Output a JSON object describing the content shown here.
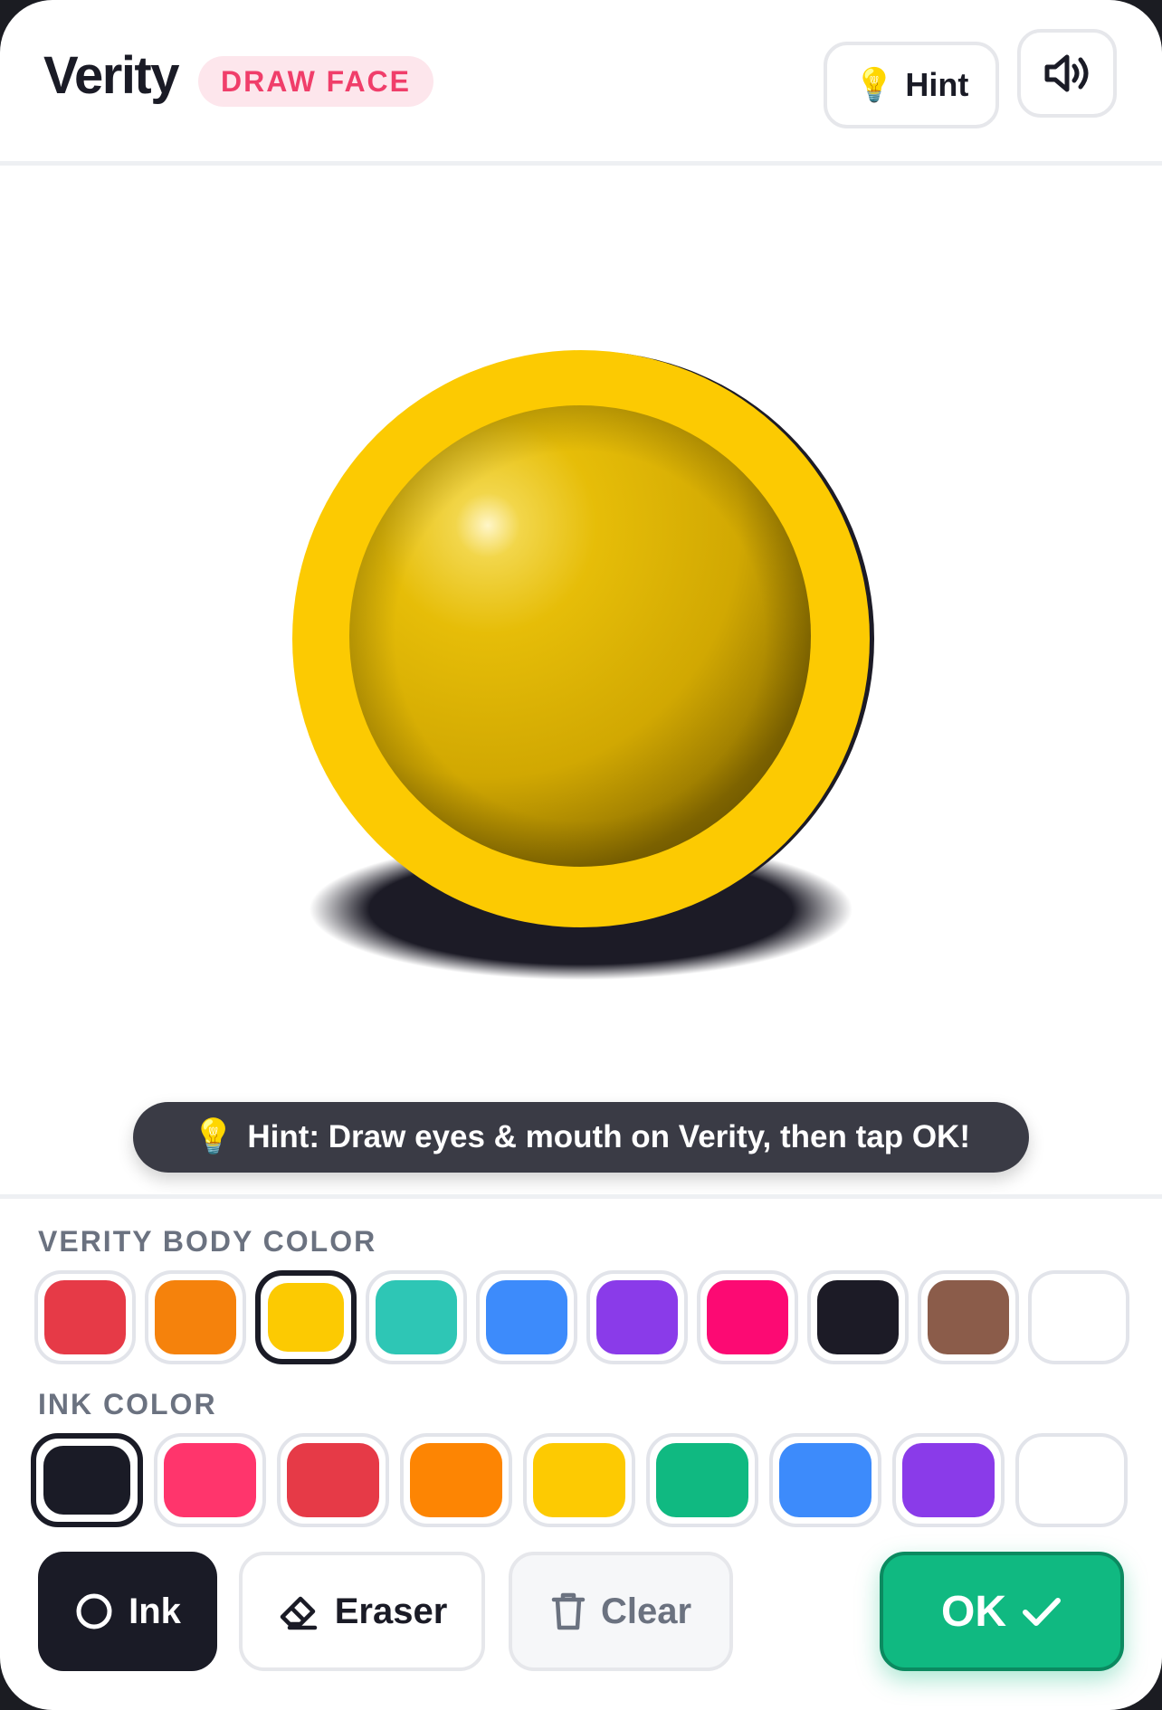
{
  "header": {
    "title": "Verity",
    "mode_badge": "DRAW FACE",
    "hint_label": "Hint",
    "hint_icon": "💡"
  },
  "canvas": {
    "hint_icon": "💡",
    "hint_text": "Hint: Draw eyes & mouth on Verity, then tap OK!"
  },
  "body_palette": {
    "label": "VERITY BODY COLOR",
    "selected": "#fcca02",
    "colors": [
      "#e63a47",
      "#f5820c",
      "#fcca02",
      "#2ec6b5",
      "#3d8bfb",
      "#8a3be9",
      "#fc0a73",
      "#1c1b26",
      "#8b5c4a",
      "#ffffff"
    ]
  },
  "ink_palette": {
    "label": "INK COLOR",
    "selected": "#1a1b26",
    "colors": [
      "#1a1b26",
      "#ff356c",
      "#e63a47",
      "#fd8503",
      "#fdca02",
      "#10b981",
      "#3d8bfb",
      "#8a3be9",
      "#ffffff"
    ]
  },
  "toolbar": {
    "ink_label": "Ink",
    "eraser_label": "Eraser",
    "clear_label": "Clear",
    "ok_label": "OK"
  },
  "theme": {
    "accent": "#10b981",
    "badge_text": "#f03e6a",
    "body_color": "#fcca02"
  }
}
